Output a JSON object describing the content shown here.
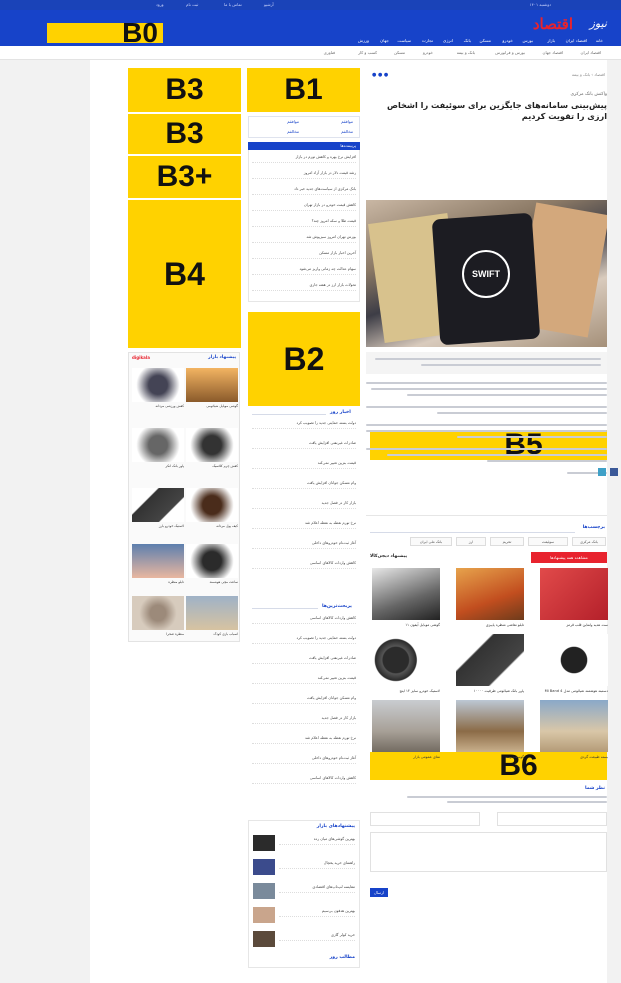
{
  "banners": {
    "b0": "B0",
    "b1": "B1",
    "b2": "B2",
    "b3a": "B3",
    "b3b": "B3",
    "b3plus": "B3+",
    "b4": "B4",
    "b5": "B5",
    "b6": "B6"
  },
  "colors": {
    "brand_blue": "#1743c9",
    "brand_red": "#e8232e",
    "ad_yellow": "#ffd200"
  },
  "topbar": {
    "left_items": [
      "ورود",
      "ثبت نام",
      "تماس با ما",
      "آرشیو"
    ],
    "right_item": "دوشنبه ۱۴۰۱"
  },
  "logo": {
    "red_text": "اقتصاد",
    "white_text": "نیوز"
  },
  "mainnav": {
    "items": [
      "خانه",
      "اقتصاد ایران",
      "بازار",
      "بورس",
      "خودرو",
      "مسکن",
      "بانک",
      "انرژی",
      "تجارت",
      "سیاست",
      "جهان",
      "ورزش"
    ]
  },
  "subnav": {
    "items": [
      "اقتصاد ایران",
      "اقتصاد جهان",
      "بورس و فرابورس",
      "بانک و بیمه",
      "خودرو",
      "مسکن",
      "کسب و کار",
      "فناوری"
    ]
  },
  "article": {
    "breadcrumb": "اقتصاد › بانک و بیمه",
    "kicker": "واکنش بانک مرکزی",
    "headline": "پیش‌بینی سامانه‌های جایگزین برای سوئیفت را اشخاص ارزی را تقویت کردیم",
    "photo_label": "SWIFT",
    "related_title": "برچسب‌ها",
    "tags": [
      "بانک مرکزی",
      "سوئیفت",
      "تحریم",
      "ارز",
      "بانک ملی ایران"
    ],
    "digi_label": "پیشنهاد دیجی‌کالا",
    "digi_button": "مشاهده همه پیشنهادها",
    "products": [
      {
        "title": "دستبند هوشمند شیائومی مدل Mi Band 4"
      },
      {
        "title": "پاور بانک شیائومی ظرفیت ۱۰۰۰۰"
      },
      {
        "title": "لاستیک خودرو سایز ۱۴ اینچ"
      },
      {
        "title": "ست هدیه ولنتاین قلب قرمز"
      },
      {
        "title": "تابلو نقاشی منظره پاییزی"
      },
      {
        "title": "گوشی موبایل آیفون ۱۱"
      },
      {
        "title": "بسته طبیعت گردی"
      },
      {
        "title": "گوسفند زنده"
      },
      {
        "title": "نمای عمومی بازار"
      }
    ],
    "comment_title": "نظر شما",
    "comment_name_label": "نام",
    "comment_email_label": "ایمیل",
    "comment_body_label": "متن نظر",
    "send_label": "ارسال"
  },
  "mid": {
    "poll_opt1": "موافقم",
    "poll_opt2": "مخالفم",
    "list_title": "پربیننده‌ها",
    "list_items": [
      "افزایش نرخ بهره و کاهش تورم در بازار",
      "رشد قیمت دلار در بازار آزاد امروز",
      "بانک مرکزی از سیاست‌های جدید خبر داد",
      "کاهش قیمت خودرو در بازار تهران",
      "قیمت طلا و سکه امروز چند؟",
      "بورس تهران امروز سبزپوش شد",
      "آخرین اخبار بازار مسکن",
      "سهام عدالت چه زمانی واریز می‌شود",
      "تحولات بازار ارز در هفته جاری"
    ],
    "section2_title": "اخبار روز",
    "section2_items": [
      "دولت بسته حمایتی جدید را تصویب کرد",
      "صادرات غیرنفتی افزایش یافت",
      "قیمت بنزین تغییر نمی‌کند",
      "وام مسکن جوانان افزایش یافت",
      "بازار کار در فصل جدید",
      "نرخ تورم نقطه به نقطه اعلام شد",
      "آغاز ثبت‌نام خودروهای داخلی",
      "کاهش واردات کالاهای اساسی"
    ],
    "section3_title": "پربحث‌ترین‌ها",
    "side_box_title": "پیشنهادهای بازار",
    "side_box_items": [
      "بهترین گوشی‌های میان رده",
      "راهنمای خرید یخچال",
      "مقایسه لپ‌تاپ‌های اقتصادی",
      "بهترین هدفون بی‌سیم",
      "خرید کولر گازی"
    ],
    "side_box_footer": "مطالب روز"
  },
  "left": {
    "title": "پیشنهاد بازار",
    "logo": "digikala",
    "products": [
      "گوشی موبایل شیائومی",
      "کفش ورزشی مردانه",
      "پاور بانک انکر",
      "کفش چرم کلاسیک",
      "کیف پول مردانه",
      "لاستیک خودرو بارز",
      "تابلو منظره",
      "ساعت مچی هوشمند",
      "منظره صحرا",
      "اسباب بازی کودک"
    ]
  }
}
